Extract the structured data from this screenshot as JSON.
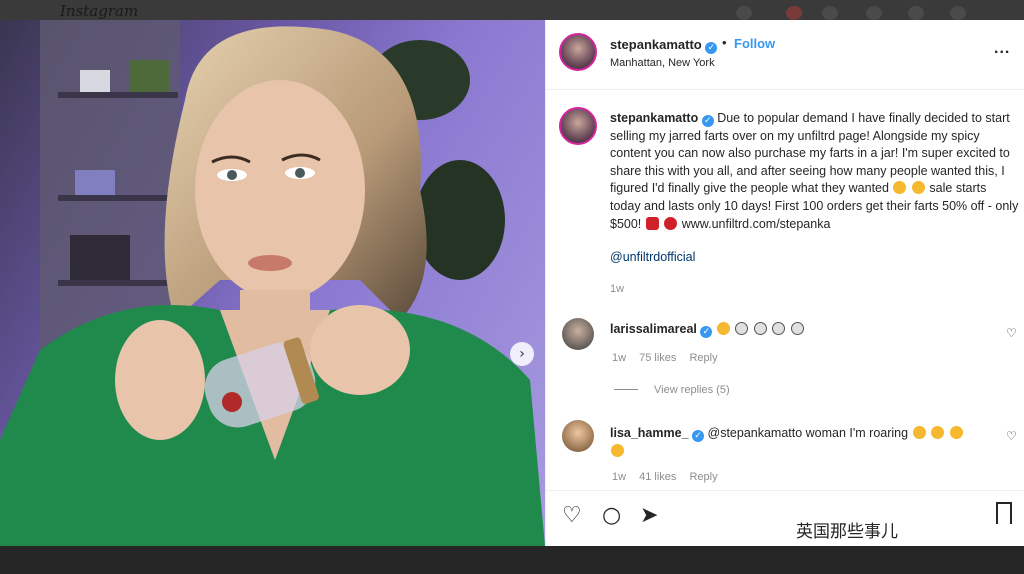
{
  "browser": {
    "logo": "Instagram"
  },
  "post": {
    "username": "stepankamatto",
    "follow_label": "Follow",
    "dot": "•",
    "location": "Manhattan, New York",
    "more": "...",
    "caption": "Due to popular demand I have finally decided to start selling my jarred farts over on my unfiltrd page! Alongside my spicy content you can now also purchase my farts in a jar! I'm super excited to share this with you all, and after seeing how many people wanted this, I figured I'd finally give the people what they wanted",
    "caption_2": "sale starts today and lasts only 10 days! First 100 orders get their farts 50% off - only $500!",
    "caption_3": "www.unfiltrd.com/stepanka",
    "mention": "@unfiltrdofficial",
    "age": "1w"
  },
  "comments": [
    {
      "username": "larissalimareal",
      "text": "",
      "age": "1w",
      "likes": "75 likes",
      "reply": "Reply",
      "view_replies": "View replies (5)"
    },
    {
      "username": "lisa_hamme_",
      "text": "@stepankamatto woman I'm roaring",
      "age": "1w",
      "likes": "41 likes",
      "reply": "Reply"
    }
  ],
  "actions": {
    "watermark": "英国那些事儿"
  },
  "colors": {
    "accent": "#3897f0",
    "photo_bg": "#8a78d0",
    "dress": "#1f8a4c"
  },
  "icons": [
    "heart-icon",
    "comment-icon",
    "share-icon",
    "bookmark-icon",
    "more-icon",
    "verified-icon",
    "next-arrow-icon"
  ]
}
